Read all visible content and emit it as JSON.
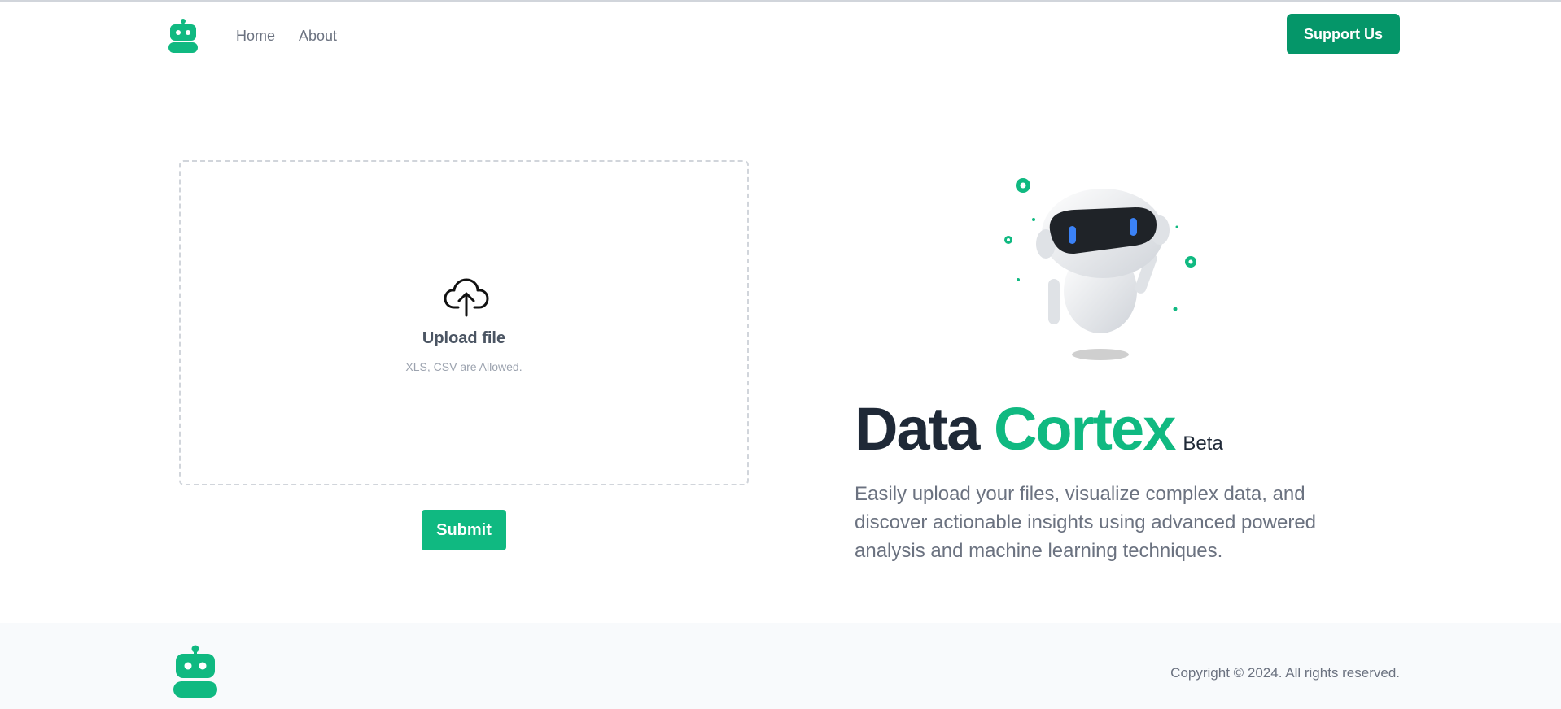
{
  "header": {
    "logo_icon": "robot-logo-icon",
    "nav": [
      {
        "label": "Home"
      },
      {
        "label": "About"
      }
    ],
    "support_label": "Support Us"
  },
  "upload": {
    "icon": "cloud-upload-icon",
    "title": "Upload file",
    "hint": "XLS, CSV are Allowed.",
    "submit_label": "Submit"
  },
  "hero": {
    "title_part1": "Data",
    "title_part2": "Cortex",
    "badge": "Beta",
    "description": "Easily upload your files, visualize complex data, and discover actionable insights using advanced powered analysis and machine learning techniques."
  },
  "footer": {
    "copyright": "Copyright © 2024. All rights reserved."
  },
  "colors": {
    "brand": "#10b981",
    "brand_dark": "#059669",
    "heading": "#1f2937",
    "muted": "#6b7280"
  }
}
